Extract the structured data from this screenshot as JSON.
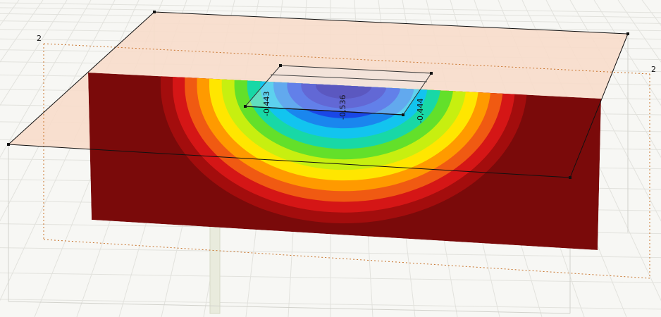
{
  "viewport": {
    "section_marker_left": "2",
    "section_marker_right": "2",
    "annotations": {
      "left": "-0,443",
      "center": "-0,536",
      "right": "-0,444"
    },
    "colors": {
      "background": "#f7f7f4",
      "grid": "#e2e2dd",
      "soil_top": "#f7dccb",
      "section_line": "#c8742c",
      "contour_levels": [
        "#7a0a0a",
        "#a30d0d",
        "#d51616",
        "#f05a12",
        "#ff9a00",
        "#ffe600",
        "#c7ef10",
        "#63e02a",
        "#18d8a6",
        "#12c4ef",
        "#1a86ee",
        "#1a47e6",
        "#1a22c8",
        "#0f0aa8"
      ]
    }
  }
}
